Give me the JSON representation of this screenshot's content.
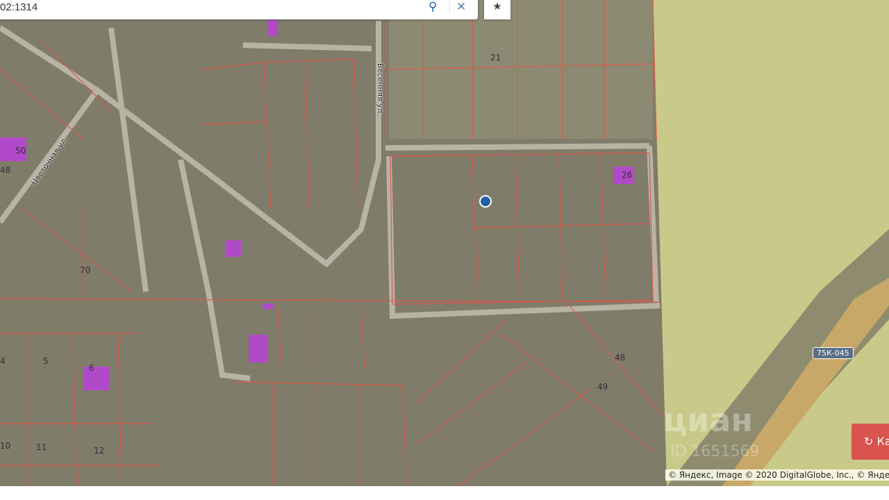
{
  "search": {
    "value": "02:1314",
    "search_icon": "search-icon",
    "clear_icon": "close-icon"
  },
  "favorite_icon": "star-icon",
  "streets": [
    "Цветочная ул.",
    "Весенняя ул."
  ],
  "plots": [
    "50",
    "48",
    "70",
    "21",
    "26",
    "48",
    "49",
    "4",
    "5",
    "6",
    "10",
    "11",
    "12"
  ],
  "route_badge": "75К-045",
  "action_button": "Ка",
  "watermark": "циан",
  "watermark_id": "ID 1651569",
  "copyright": "© Яндекс, Image © 2020 DigitalGlobe, Inc., © Яндекс",
  "colors": {
    "parcel_border": "#e0584a",
    "highlight_zone": "#e8e48a",
    "building": "#b04ac8",
    "marker": "#1f5fa8",
    "button": "#d9534f"
  }
}
